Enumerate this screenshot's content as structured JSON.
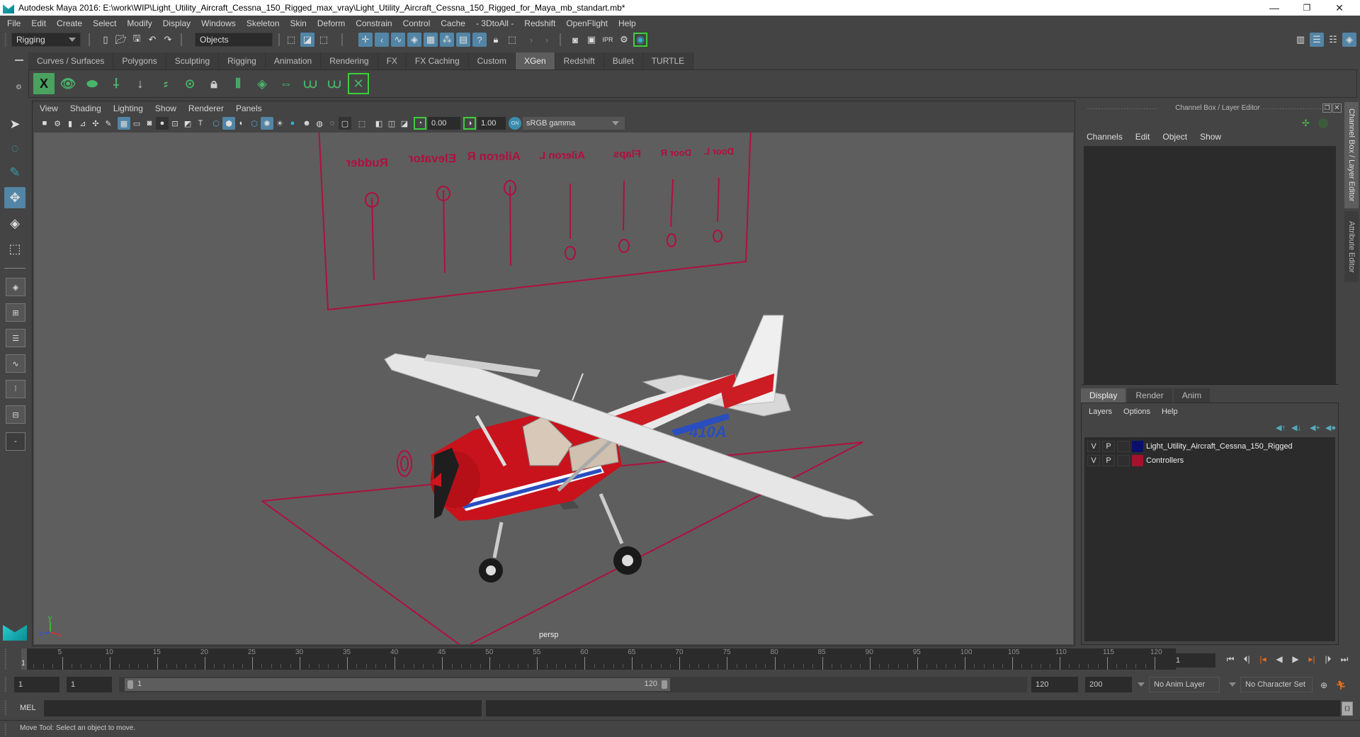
{
  "window": {
    "title": "Autodesk Maya 2016: E:\\work\\WIP\\Light_Utility_Aircraft_Cessna_150_Rigged_max_vray\\Light_Utility_Aircraft_Cessna_150_Rigged_for_Maya_mb_standart.mb*",
    "minimize_glyph": "—",
    "restore_glyph": "❐",
    "close_glyph": "✕"
  },
  "menubar": [
    "File",
    "Edit",
    "Create",
    "Select",
    "Modify",
    "Display",
    "Windows",
    "Skeleton",
    "Skin",
    "Deform",
    "Constrain",
    "Control",
    "Cache",
    "- 3DtoAll -",
    "Redshift",
    "OpenFlight",
    "Help"
  ],
  "statusline": {
    "menuset": "Rigging",
    "selection_mode": "Objects"
  },
  "shelf": {
    "tabs": [
      "Curves / Surfaces",
      "Polygons",
      "Sculpting",
      "Rigging",
      "Animation",
      "Rendering",
      "FX",
      "FX Caching",
      "Custom",
      "XGen",
      "Redshift",
      "Bullet",
      "TURTLE"
    ],
    "active_tab": "XGen",
    "icons": [
      "xgen-editor-icon",
      "preview-icon",
      "clear-preview-icon",
      "add-primitive-icon",
      "place-guide-icon",
      "add-guide-icon",
      "guide-visibility-icon",
      "lock-guide-icon",
      "bend-guide-icon",
      "region-map-icon",
      "guide-length-icon",
      "select-guide-icon",
      "toggle-guide-icon",
      "delete-guide-icon"
    ]
  },
  "viewport": {
    "menus": [
      "View",
      "Shading",
      "Lighting",
      "Show",
      "Renderer",
      "Panels"
    ],
    "exposure": "0.00",
    "gamma": "1.00",
    "color_space": "sRGB gamma",
    "camera_label": "persp",
    "axis": {
      "x": "x",
      "y": "y",
      "z": "z"
    },
    "controller_labels": [
      "Rudder",
      "Elevator",
      "Aileron R",
      "Aileron L",
      "Flaps",
      "Door R",
      "Door L"
    ],
    "tail_number": "410A",
    "controller_color": "#b0103f"
  },
  "channel_box": {
    "title": "Channel Box / Layer Editor",
    "menus": [
      "Channels",
      "Edit",
      "Object",
      "Show"
    ]
  },
  "layer_editor": {
    "tabs": [
      "Display",
      "Render",
      "Anim"
    ],
    "active_tab": "Display",
    "menus": [
      "Layers",
      "Options",
      "Help"
    ],
    "layers": [
      {
        "v": "V",
        "p": "P",
        "color": "#0a0f6e",
        "name": "Light_Utility_Aircraft_Cessna_150_Rigged"
      },
      {
        "v": "V",
        "p": "P",
        "color": "#a8102e",
        "name": "Controllers"
      }
    ]
  },
  "side_tabs": [
    "Channel Box / Layer Editor",
    "Attribute Editor"
  ],
  "timeline": {
    "ticks": [
      "5",
      "10",
      "15",
      "20",
      "25",
      "30",
      "35",
      "40",
      "45",
      "50",
      "55",
      "60",
      "65",
      "70",
      "75",
      "80",
      "85",
      "90",
      "95",
      "100",
      "105",
      "110",
      "115",
      "120"
    ],
    "current_frame_marker": "1",
    "current_frame": "1",
    "start": 1,
    "end": 120
  },
  "range": {
    "anim_start": "1",
    "playback_start": "1",
    "slider_start": "1",
    "slider_end": "120",
    "playback_end": "120",
    "anim_end": "200",
    "anim_layer": "No Anim Layer",
    "character_set": "No Character Set"
  },
  "command_line": {
    "language": "MEL",
    "input": "",
    "result": ""
  },
  "help_line": "Move Tool: Select an object to move."
}
